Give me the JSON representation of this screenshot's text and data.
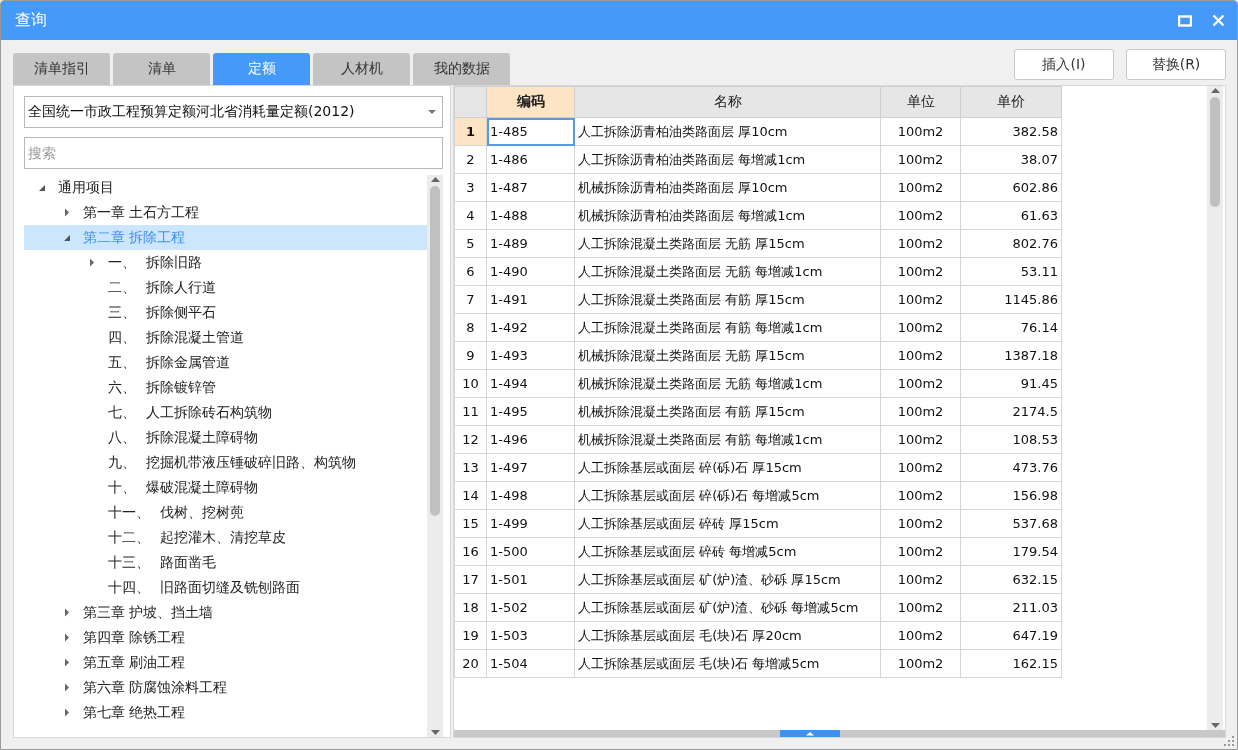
{
  "window": {
    "title": "查询"
  },
  "tabs": [
    {
      "label": "清单指引",
      "selected": false
    },
    {
      "label": "清单",
      "selected": false
    },
    {
      "label": "定额",
      "selected": true
    },
    {
      "label": "人材机",
      "selected": false
    },
    {
      "label": "我的数据",
      "selected": false
    }
  ],
  "buttons": [
    "插入(I)",
    "替换(R)"
  ],
  "library_select": {
    "value": "全国统一市政工程预算定额河北省消耗量定额(2012)"
  },
  "search": {
    "placeholder": "搜索"
  },
  "tree": [
    {
      "label": "通用项目",
      "expanded": true,
      "selected": false,
      "children": [
        {
          "label": "第一章 土石方工程",
          "expanded": false,
          "selected": false
        },
        {
          "label": "第二章 拆除工程",
          "expanded": true,
          "selected": true,
          "children": [
            {
              "num": "一、",
              "label": "拆除旧路",
              "expanded": false,
              "selected": false
            },
            {
              "num": "二、",
              "label": "拆除人行道",
              "selected": false
            },
            {
              "num": "三、",
              "label": "拆除侧平石",
              "selected": false
            },
            {
              "num": "四、",
              "label": "拆除混凝土管道",
              "selected": false
            },
            {
              "num": "五、",
              "label": "拆除金属管道",
              "selected": false
            },
            {
              "num": "六、",
              "label": "拆除镀锌管",
              "selected": false
            },
            {
              "num": "七、",
              "label": "人工拆除砖石构筑物",
              "selected": false
            },
            {
              "num": "八、",
              "label": "拆除混凝土障碍物",
              "selected": false
            },
            {
              "num": "九、",
              "label": "挖掘机带液压锤破碎旧路、构筑物",
              "selected": false
            },
            {
              "num": "十、",
              "label": "爆破混凝土障碍物",
              "selected": false
            },
            {
              "num": "十一、",
              "label": "伐树、挖树蔸",
              "selected": false
            },
            {
              "num": "十二、",
              "label": "起挖灌木、清挖草皮",
              "selected": false
            },
            {
              "num": "十三、",
              "label": "路面凿毛",
              "selected": false
            },
            {
              "num": "十四、",
              "label": "旧路面切缝及铣刨路面",
              "selected": false
            }
          ]
        },
        {
          "label": "第三章 护坡、挡土墙",
          "expanded": false,
          "selected": false
        },
        {
          "label": "第四章 除锈工程",
          "expanded": false,
          "selected": false
        },
        {
          "label": "第五章 刷油工程",
          "expanded": false,
          "selected": false
        },
        {
          "label": "第六章 防腐蚀涂料工程",
          "expanded": false,
          "selected": false
        },
        {
          "label": "第七章 绝热工程",
          "expanded": false,
          "selected": false
        }
      ]
    }
  ],
  "table": {
    "columns": [
      {
        "label": "编码",
        "selected": true
      },
      {
        "label": "名称",
        "selected": false
      },
      {
        "label": "单位",
        "selected": false
      },
      {
        "label": "单价",
        "selected": false
      }
    ],
    "rows": [
      {
        "num": "1",
        "code": "1-485",
        "name": "人工拆除沥青柏油类路面层 厚10cm",
        "unit": "100m2",
        "price": "382.58",
        "selected": true
      },
      {
        "num": "2",
        "code": "1-486",
        "name": "人工拆除沥青柏油类路面层 每增减1cm",
        "unit": "100m2",
        "price": "38.07",
        "selected": false
      },
      {
        "num": "3",
        "code": "1-487",
        "name": "机械拆除沥青柏油类路面层 厚10cm",
        "unit": "100m2",
        "price": "602.86",
        "selected": false
      },
      {
        "num": "4",
        "code": "1-488",
        "name": "机械拆除沥青柏油类路面层 每增减1cm",
        "unit": "100m2",
        "price": "61.63",
        "selected": false
      },
      {
        "num": "5",
        "code": "1-489",
        "name": "人工拆除混凝土类路面层 无筋 厚15cm",
        "unit": "100m2",
        "price": "802.76",
        "selected": false
      },
      {
        "num": "6",
        "code": "1-490",
        "name": "人工拆除混凝土类路面层 无筋 每增减1cm",
        "unit": "100m2",
        "price": "53.11",
        "selected": false
      },
      {
        "num": "7",
        "code": "1-491",
        "name": "人工拆除混凝土类路面层 有筋 厚15cm",
        "unit": "100m2",
        "price": "1145.86",
        "selected": false
      },
      {
        "num": "8",
        "code": "1-492",
        "name": "人工拆除混凝土类路面层 有筋 每增减1cm",
        "unit": "100m2",
        "price": "76.14",
        "selected": false
      },
      {
        "num": "9",
        "code": "1-493",
        "name": "机械拆除混凝土类路面层 无筋 厚15cm",
        "unit": "100m2",
        "price": "1387.18",
        "selected": false
      },
      {
        "num": "10",
        "code": "1-494",
        "name": "机械拆除混凝土类路面层 无筋 每增减1cm",
        "unit": "100m2",
        "price": "91.45",
        "selected": false
      },
      {
        "num": "11",
        "code": "1-495",
        "name": "机械拆除混凝土类路面层 有筋 厚15cm",
        "unit": "100m2",
        "price": "2174.5",
        "selected": false
      },
      {
        "num": "12",
        "code": "1-496",
        "name": "机械拆除混凝土类路面层 有筋 每增减1cm",
        "unit": "100m2",
        "price": "108.53",
        "selected": false
      },
      {
        "num": "13",
        "code": "1-497",
        "name": "人工拆除基层或面层 碎(砾)石 厚15cm",
        "unit": "100m2",
        "price": "473.76",
        "selected": false
      },
      {
        "num": "14",
        "code": "1-498",
        "name": "人工拆除基层或面层 碎(砾)石 每增减5cm",
        "unit": "100m2",
        "price": "156.98",
        "selected": false
      },
      {
        "num": "15",
        "code": "1-499",
        "name": "人工拆除基层或面层 碎砖 厚15cm",
        "unit": "100m2",
        "price": "537.68",
        "selected": false
      },
      {
        "num": "16",
        "code": "1-500",
        "name": "人工拆除基层或面层 碎砖 每增减5cm",
        "unit": "100m2",
        "price": "179.54",
        "selected": false
      },
      {
        "num": "17",
        "code": "1-501",
        "name": "人工拆除基层或面层 矿(炉)渣、砂砾 厚15cm",
        "unit": "100m2",
        "price": "632.15",
        "selected": false
      },
      {
        "num": "18",
        "code": "1-502",
        "name": "人工拆除基层或面层 矿(炉)渣、砂砾 每增减5cm",
        "unit": "100m2",
        "price": "211.03",
        "selected": false
      },
      {
        "num": "19",
        "code": "1-503",
        "name": "人工拆除基层或面层 毛(块)石 厚20cm",
        "unit": "100m2",
        "price": "647.19",
        "selected": false
      },
      {
        "num": "20",
        "code": "1-504",
        "name": "人工拆除基层或面层 毛(块)石 每增减5cm",
        "unit": "100m2",
        "price": "162.15",
        "selected": false
      }
    ]
  }
}
